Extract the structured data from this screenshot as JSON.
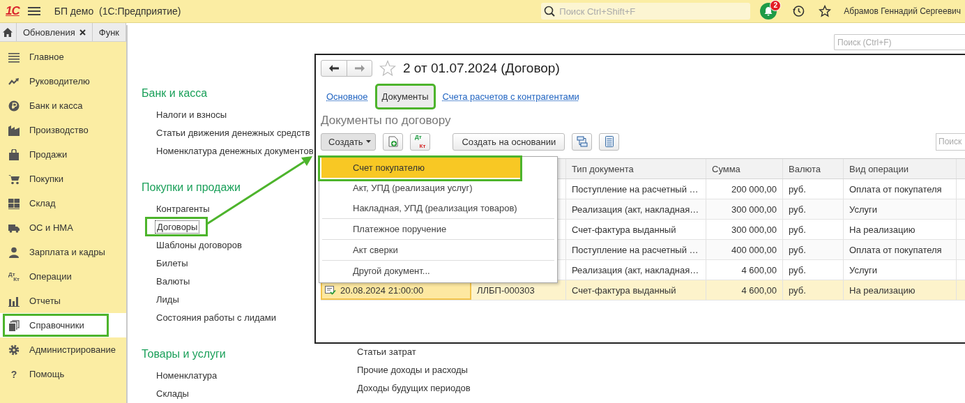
{
  "app_bar": {
    "logo": "1С",
    "title": "БП демо  (1С:Предприятие)",
    "search": {
      "placeholder": "Поиск Ctrl+Shift+F"
    },
    "notifications": "2",
    "user": "Абрамов Геннадий Сергеевич"
  },
  "open_tabs": [
    {
      "label": "Обновления",
      "closable": true
    },
    {
      "label": "Функ",
      "closable": false
    }
  ],
  "sidebar": {
    "items": [
      {
        "label": "Главное",
        "selected": false,
        "highlighted": false
      },
      {
        "label": "Руководителю",
        "selected": false,
        "highlighted": false
      },
      {
        "label": "Банк и касса",
        "selected": false,
        "highlighted": false
      },
      {
        "label": "Производство",
        "selected": false,
        "highlighted": false
      },
      {
        "label": "Продажи",
        "selected": false,
        "highlighted": false
      },
      {
        "label": "Покупки",
        "selected": false,
        "highlighted": false
      },
      {
        "label": "Склад",
        "selected": false,
        "highlighted": false
      },
      {
        "label": "ОС и НМА",
        "selected": false,
        "highlighted": false
      },
      {
        "label": "Зарплата и кадры",
        "selected": false,
        "highlighted": false
      },
      {
        "label": "Операции",
        "selected": false,
        "highlighted": false,
        "icon_text": [
          "Дт",
          "Кт"
        ]
      },
      {
        "label": "Отчеты",
        "selected": false,
        "highlighted": false
      },
      {
        "label": "Справочники",
        "selected": true,
        "highlighted": true
      },
      {
        "label": "Администрирование",
        "selected": false,
        "highlighted": false
      },
      {
        "label": "Помощь",
        "selected": false,
        "highlighted": false,
        "icon_text": [
          "?"
        ]
      }
    ]
  },
  "catalog": {
    "search": {
      "placeholder": "Поиск (Ctrl+F)"
    },
    "columns": [
      {
        "sections": [
          {
            "title": "Банк и касса",
            "items": [
              {
                "label": "Налоги и взносы",
                "highlighted": false,
                "focused": false
              },
              {
                "label": "Статьи движения денежных средств",
                "highlighted": false,
                "focused": false
              },
              {
                "label": "Номенклатура денежных документов",
                "highlighted": false,
                "focused": false
              }
            ]
          },
          {
            "title": "Покупки и продажи",
            "items": [
              {
                "label": "Контрагенты",
                "highlighted": false,
                "focused": false
              },
              {
                "label": "Договоры",
                "highlighted": true,
                "focused": true
              },
              {
                "label": "Шаблоны договоров",
                "highlighted": false,
                "focused": false
              },
              {
                "label": "Билеты",
                "highlighted": false,
                "focused": false
              },
              {
                "label": "Валюты",
                "highlighted": false,
                "focused": false
              },
              {
                "label": "Лиды",
                "highlighted": false,
                "focused": false
              },
              {
                "label": "Состояния работы с лидами",
                "highlighted": false,
                "focused": false
              }
            ]
          },
          {
            "title": "Товары и услуги",
            "items": [
              {
                "label": "Номенклатура",
                "highlighted": false,
                "focused": false
              },
              {
                "label": "Склады",
                "highlighted": false,
                "focused": false
              }
            ]
          }
        ]
      },
      {
        "sections": [
          {
            "items": [
              {
                "label": "Статьи затрат",
                "highlighted": false,
                "focused": false
              },
              {
                "label": "Прочие доходы и расходы",
                "highlighted": false,
                "focused": false
              },
              {
                "label": "Доходы будущих периодов",
                "highlighted": false,
                "focused": false
              }
            ]
          }
        ]
      }
    ]
  },
  "document_window": {
    "title": "2 от 01.07.2024 (Договор)",
    "favorite": false,
    "tabs": [
      {
        "label": "Основное",
        "selected": false,
        "highlighted": false
      },
      {
        "label": "Документы",
        "selected": true,
        "highlighted": true
      },
      {
        "label": "Счета расчетов с контрагентами",
        "selected": false,
        "highlighted": false
      }
    ],
    "heading": "Документы по договору",
    "toolbar": {
      "create": "Создать",
      "posting_icon": [
        "Дт",
        "Кт"
      ],
      "create_based": "Создать на основании",
      "search": {
        "placeholder": "Поиск"
      }
    },
    "create_menu": {
      "groups": [
        [
          {
            "label": "Счет покупателю",
            "selected": true,
            "highlighted": true
          },
          {
            "label": "Акт, УПД (реализация услуг)",
            "selected": false,
            "highlighted": false
          },
          {
            "label": "Накладная, УПД (реализация товаров)",
            "selected": false,
            "highlighted": false
          }
        ],
        [
          {
            "label": "Платежное поручение",
            "selected": false,
            "highlighted": false
          }
        ],
        [
          {
            "label": "Акт сверки",
            "selected": false,
            "highlighted": false
          }
        ],
        [
          {
            "label": "Другой документ...",
            "selected": false,
            "highlighted": false
          }
        ]
      ]
    },
    "table": {
      "columns": [
        {
          "label": "Тип документа"
        },
        {
          "label": "Сумма"
        },
        {
          "label": "Валюта"
        },
        {
          "label": "Вид операции"
        }
      ],
      "rows": [
        {
          "type": "Поступление на расчетный …",
          "amount": "200 000,00",
          "currency": "руб.",
          "operation": "Оплата от покупателя",
          "selected": false
        },
        {
          "type": "Реализация (акт, накладная…",
          "amount": "300 000,00",
          "currency": "руб.",
          "operation": "Услуги",
          "selected": false
        },
        {
          "type": "Счет-фактура выданный",
          "amount": "300 000,00",
          "currency": "руб.",
          "operation": "На реализацию",
          "selected": false
        },
        {
          "type": "Поступление на расчетный …",
          "amount": "400 000,00",
          "currency": "руб.",
          "operation": "Оплата от покупателя",
          "selected": false
        },
        {
          "type": "Реализация (акт, накладная…",
          "amount": "4 600,00",
          "currency": "руб.",
          "operation": "Услуги",
          "selected": false
        },
        {
          "date": "20.08.2024 21:00:00",
          "number": "ЛЛБП-000303",
          "type": "Счет-фактура выданный",
          "amount": "4 600,00",
          "currency": "руб.",
          "operation": "На реализацию",
          "selected": true
        }
      ]
    }
  }
}
